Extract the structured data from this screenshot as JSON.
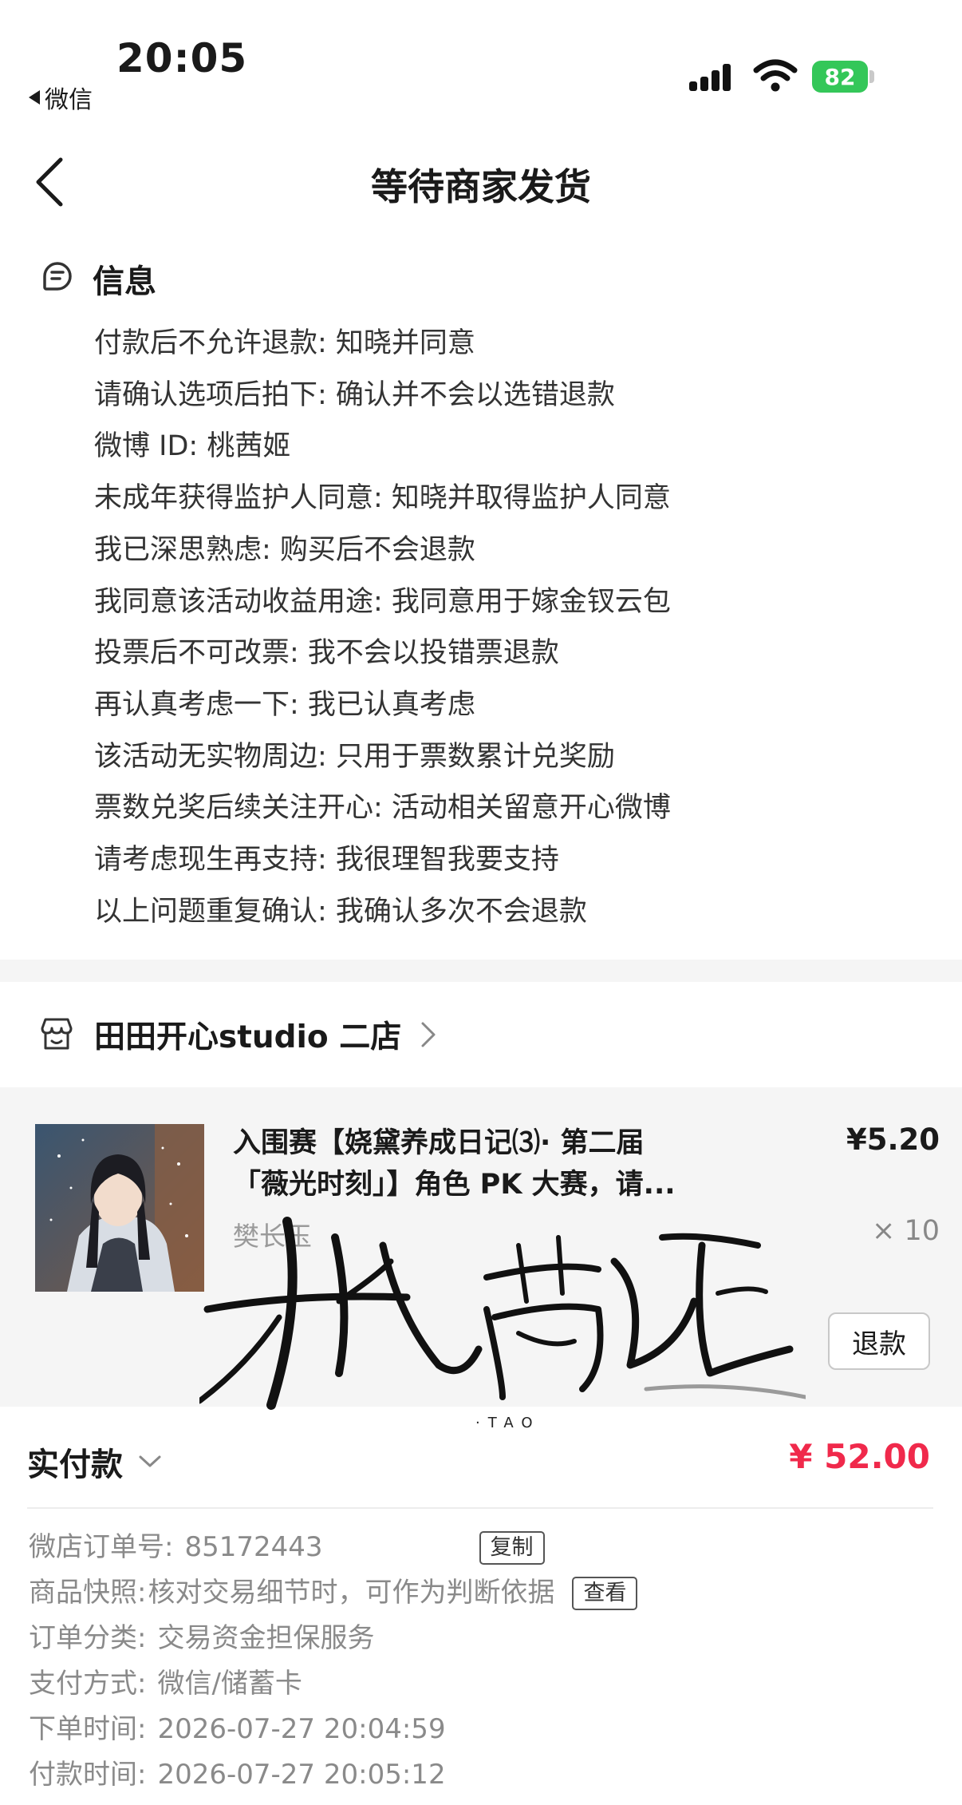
{
  "status_bar": {
    "time": "20:05",
    "back_app": "微信",
    "battery": "82"
  },
  "nav": {
    "title": "等待商家发货"
  },
  "info": {
    "title": "信息",
    "items": [
      "付款后不允许退款: 知晓并同意",
      "请确认选项后拍下: 确认并不会以选错退款",
      "微博 ID: 桃茜姬",
      "未成年获得监护人同意: 知晓并取得监护人同意",
      "我已深思熟虑: 购买后不会退款",
      "我同意该活动收益用途: 我同意用于嫁金钗云包",
      "投票后不可改票: 我不会以投错票退款",
      "再认真考虑一下: 我已认真考虑",
      "该活动无实物周边: 只用于票数累计兑奖励",
      "票数兑奖后续关注开心: 活动相关留意开心微博",
      "请考虑现生再支持: 我很理智我要支持",
      "以上问题重复确认: 我确认多次不会退款"
    ]
  },
  "shop": {
    "name": "田田开心studio 二店"
  },
  "product": {
    "title": "入围赛【娆黛养成日记⑶· 第二届「薇光时刻」】角色 PK 大赛，请...",
    "price": "¥5.20",
    "subtitle": "樊长玉",
    "quantity": "× 10",
    "refund_label": "退款"
  },
  "watermark": {
    "text": "桃茜姬",
    "sub": "·TAO"
  },
  "payment": {
    "label": "实付款",
    "amount": "¥ 52.00",
    "rows": [
      {
        "key": "微店订单号:",
        "value": "85172443",
        "button": "复制"
      },
      {
        "key": "商品快照:",
        "value": "核对交易细节时，可作为判断依据",
        "button": "查看"
      },
      {
        "key": "订单分类:",
        "value": "交易资金担保服务"
      },
      {
        "key": "支付方式:",
        "value": "微信/储蓄卡"
      },
      {
        "key": "下单时间:",
        "value": "2026-07-27 20:04:59"
      },
      {
        "key": "付款时间:",
        "value": "2026-07-27 20:05:12"
      }
    ]
  },
  "colors": {
    "accent_red": "#f0294b",
    "battery_green": "#34c759",
    "panel_gray": "#f5f5f5"
  }
}
